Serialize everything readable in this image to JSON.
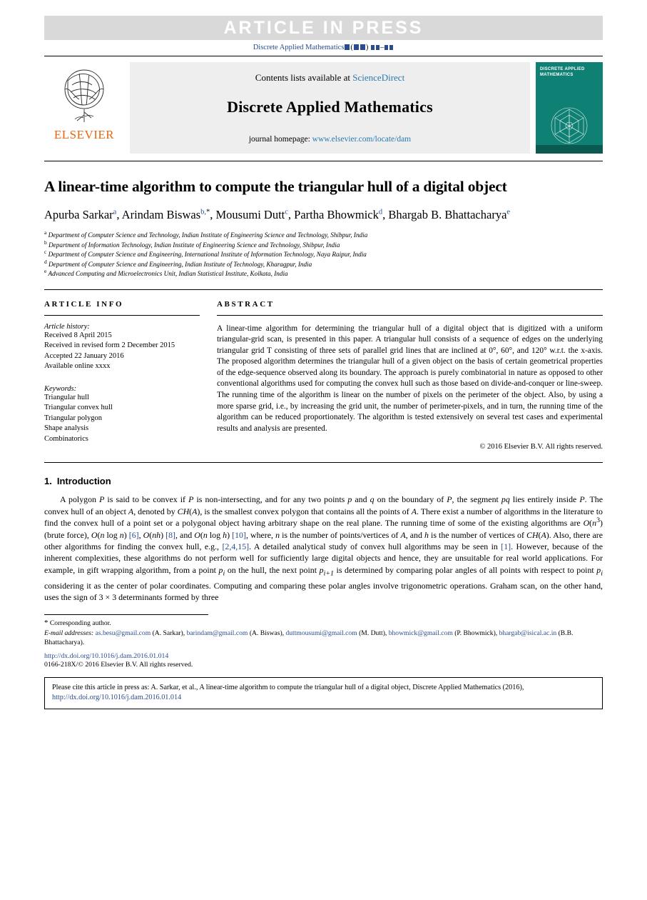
{
  "banner": {
    "text": "ARTICLE IN PRESS",
    "journal_ref_prefix": "Discrete Applied Mathematics"
  },
  "masthead": {
    "publisher": "ELSEVIER",
    "contents_prefix": "Contents lists available at ",
    "contents_link": "ScienceDirect",
    "journal_title": "Discrete Applied Mathematics",
    "homepage_prefix": "journal homepage: ",
    "homepage_link": "www.elsevier.com/locate/dam",
    "cover_title": "DISCRETE APPLIED MATHEMATICS"
  },
  "article": {
    "title": "A linear-time algorithm to compute the triangular hull of a digital object",
    "authors_html": "Apurba Sarkar<sup>a</sup>, Arindam Biswas<sup>b,</sup><sup class=\"blk\">*</sup>, Mousumi Dutt<sup>c</sup>, Partha Bhowmick<sup>d</sup>, Bhargab B. Bhattacharya<sup>e</sup>",
    "affiliations": [
      {
        "mark": "a",
        "text": "Department of Computer Science and Technology, Indian Institute of Engineering Science and Technology, Shibpur, India"
      },
      {
        "mark": "b",
        "text": "Department of Information Technology, Indian Institute of Engineering Science and Technology, Shibpur, India"
      },
      {
        "mark": "c",
        "text": "Department of Computer Science and Engineering, International Institute of Information Technology, Naya Raipur, India"
      },
      {
        "mark": "d",
        "text": "Department of Computer Science and Engineering, Indian Institute of Technology, Kharagpur, India"
      },
      {
        "mark": "e",
        "text": "Advanced Computing and Microelectronics Unit, Indian Statistical Institute, Kolkata, India"
      }
    ]
  },
  "info": {
    "heading": "ARTICLE INFO",
    "history_label": "Article history:",
    "history": [
      "Received 8 April 2015",
      "Received in revised form 2 December 2015",
      "Accepted 22 January 2016",
      "Available online xxxx"
    ],
    "keywords_label": "Keywords:",
    "keywords": [
      "Triangular hull",
      "Triangular convex hull",
      "Triangular polygon",
      "Shape analysis",
      "Combinatorics"
    ]
  },
  "abstract": {
    "heading": "ABSTRACT",
    "text": "A linear-time algorithm for determining the triangular hull of a digital object that is digitized with a uniform triangular-grid scan, is presented in this paper. A triangular hull consists of a sequence of edges on the underlying triangular grid T consisting of three sets of parallel grid lines that are inclined at 0°, 60°, and 120° w.r.t. the x-axis. The proposed algorithm determines the triangular hull of a given object on the basis of certain geometrical properties of the edge-sequence observed along its boundary. The approach is purely combinatorial in nature as opposed to other conventional algorithms used for computing the convex hull such as those based on divide-and-conquer or line-sweep. The running time of the algorithm is linear on the number of pixels on the perimeter of the object. Also, by using a more sparse grid, i.e., by increasing the grid unit, the number of perimeter-pixels, and in turn, the running time of the algorithm can be reduced proportionately. The algorithm is tested extensively on several test cases and experimental results and analysis are presented.",
    "copyright": "© 2016 Elsevier B.V. All rights reserved."
  },
  "section": {
    "number": "1.",
    "title": "Introduction",
    "paragraph_html": "A polygon <span class=\"mi\">P</span> is said to be convex if <span class=\"mi\">P</span> is non-intersecting, and for any two points <span class=\"mi\">p</span> and <span class=\"mi\">q</span> on the boundary of <span class=\"mi\">P</span>, the segment <span class=\"mi\">pq</span> lies entirely inside <span class=\"mi\">P</span>. The convex hull of an object <span class=\"mi\">A</span>, denoted by <span class=\"mi\">CH</span>(<span class=\"mi\">A</span>), is the smallest convex polygon that contains all the points of <span class=\"mi\">A</span>. There exist a number of algorithms in the literature to find the convex hull of a point set or a polygonal object having arbitrary shape on the real plane. The running time of some of the existing algorithms are <span class=\"mi\">O</span>(<span class=\"mi\">n</span><sup>3</sup>) (brute force), <span class=\"mi\">O</span>(<span class=\"mi\">n</span> log <span class=\"mi\">n</span>) <span class=\"lnk\">[6]</span>, <span class=\"mi\">O</span>(<span class=\"mi\">nh</span>) <span class=\"lnk\">[8]</span>, and <span class=\"mi\">O</span>(<span class=\"mi\">n</span> log <span class=\"mi\">h</span>) <span class=\"lnk\">[10]</span>, where, <span class=\"mi\">n</span> is the number of points/vertices of <span class=\"mi\">A</span>, and <span class=\"mi\">h</span> is the number of vertices of <span class=\"mi\">CH</span>(<span class=\"mi\">A</span>). Also, there are other algorithms for finding the convex hull, e.g., <span class=\"lnk\">[2,4,15]</span>. A detailed analytical study of convex hull algorithms may be seen in <span class=\"lnk\">[1]</span>. However, because of the inherent complexities, these algorithms do not perform well for sufficiently large digital objects and hence, they are unsuitable for real world applications. For example, in gift wrapping algorithm, from a point <span class=\"mi\">p<sub>i</sub></span> on the hull, the next point <span class=\"mi\">p<sub>i+1</sub></span> is determined by comparing polar angles of all points with respect to point <span class=\"mi\">p<sub>i</sub></span> considering it as the center of polar coordinates. Computing and comparing these polar angles involve trigonometric operations. Graham scan, on the other hand, uses the sign of 3 × 3 determinants formed by three"
  },
  "footnote": {
    "corresponding": "Corresponding author.",
    "email_label": "E-mail addresses:",
    "emails": [
      {
        "addr": "as.besu@gmail.com",
        "name": "(A. Sarkar),"
      },
      {
        "addr": "barindam@gmail.com",
        "name": "(A. Biswas),"
      },
      {
        "addr": "duttmousumi@gmail.com",
        "name": "(M. Dutt),"
      },
      {
        "addr": "bhowmick@gmail.com",
        "name": ""
      },
      {
        "addr": "",
        "name": "(P. Bhowmick),"
      },
      {
        "addr": "bhargab@isical.ac.in",
        "name": "(B.B. Bhattacharya)."
      }
    ],
    "doi": "http://dx.doi.org/10.1016/j.dam.2016.01.014",
    "issn": "0166-218X/© 2016 Elsevier B.V. All rights reserved."
  },
  "cite_box": {
    "text_prefix": "Please cite this article in press as: A. Sarkar, et al., A linear-time algorithm to compute the triangular hull of a digital object, Discrete Applied Mathematics (2016), ",
    "link": "http://dx.doi.org/10.1016/j.dam.2016.01.014"
  },
  "colors": {
    "link": "#2a4b8d",
    "sciencedirect": "#2a7ab0",
    "elsevier_orange": "#ea650d",
    "cover_green": "#0e8074",
    "banner_grey": "#d9d9d9"
  }
}
